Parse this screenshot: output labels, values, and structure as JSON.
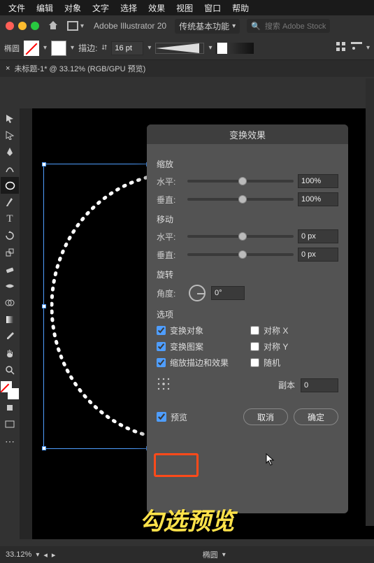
{
  "menu": {
    "items": [
      "文件",
      "编辑",
      "对象",
      "文字",
      "选择",
      "效果",
      "视图",
      "窗口",
      "帮助"
    ]
  },
  "header": {
    "app": "Adobe Illustrator 20",
    "workspace": "传统基本功能",
    "search_placeholder": "搜索 Adobe Stock"
  },
  "control": {
    "selection": "椭圆",
    "stroke_label": "描边:",
    "stroke_weight": "16 pt"
  },
  "tab": {
    "label": "未标题-1* @ 33.12% (RGB/GPU 预览)"
  },
  "dialog": {
    "title": "变换效果",
    "scale": {
      "label": "缩放",
      "h_label": "水平:",
      "v_label": "垂直:",
      "h": "100%",
      "v": "100%"
    },
    "move": {
      "label": "移动",
      "h_label": "水平:",
      "v_label": "垂直:",
      "h": "0 px",
      "v": "0 px"
    },
    "rotate": {
      "label": "旋转",
      "angle_label": "角度:",
      "angle": "0°"
    },
    "options": {
      "label": "选项",
      "transform_obj": "变换对象",
      "transform_pat": "变换图案",
      "scale_stroke": "缩放描边和效果",
      "mirrorx": "对称 X",
      "mirrory": "对称 Y",
      "random": "随机"
    },
    "copies": {
      "label": "副本",
      "value": "0"
    },
    "preview": "预览",
    "cancel": "取消",
    "ok": "确定"
  },
  "caption": "勾选预览",
  "status": {
    "zoom": "33.12%",
    "obj": "椭圆"
  },
  "chart_data": {
    "type": "none"
  }
}
